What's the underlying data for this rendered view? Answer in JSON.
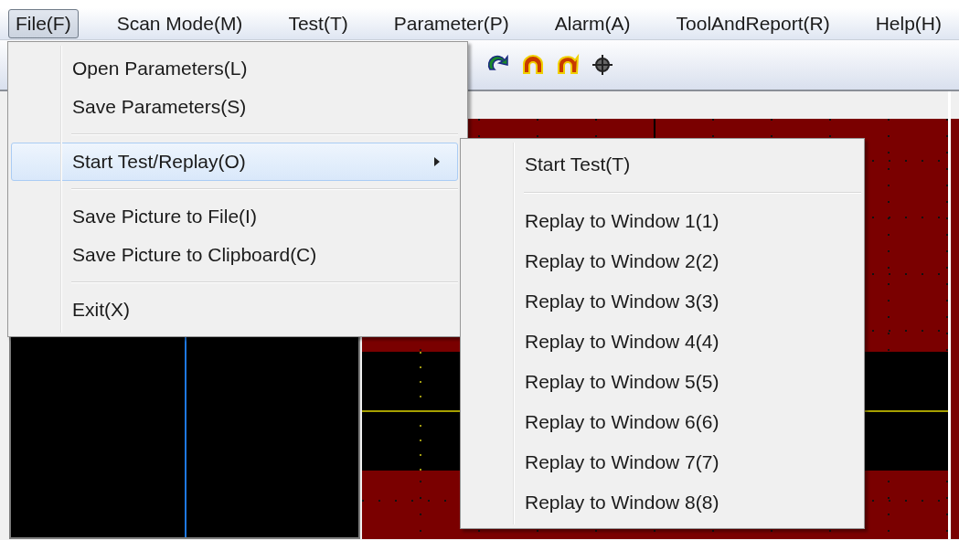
{
  "menubar": [
    {
      "label": "File(F)",
      "selected": true
    },
    {
      "label": "Scan Mode(M)",
      "selected": false
    },
    {
      "label": "Test(T)",
      "selected": false
    },
    {
      "label": "Parameter(P)",
      "selected": false
    },
    {
      "label": "Alarm(A)",
      "selected": false
    },
    {
      "label": "ToolAndReport(R)",
      "selected": false
    },
    {
      "label": "Help(H)",
      "selected": false
    }
  ],
  "file_menu": [
    {
      "kind": "item",
      "label": "Open Parameters(L)",
      "highlighted": false
    },
    {
      "kind": "item",
      "label": "Save Parameters(S)",
      "highlighted": false
    },
    {
      "kind": "separator"
    },
    {
      "kind": "submenu",
      "label": "Start Test/Replay(O)",
      "highlighted": true
    },
    {
      "kind": "separator"
    },
    {
      "kind": "item",
      "label": "Save Picture to File(I)",
      "highlighted": false
    },
    {
      "kind": "item",
      "label": "Save Picture to Clipboard(C)",
      "highlighted": false
    },
    {
      "kind": "separator"
    },
    {
      "kind": "item",
      "label": "Exit(X)",
      "highlighted": false
    }
  ],
  "submenu": [
    {
      "kind": "item",
      "label": "Start Test(T)"
    },
    {
      "kind": "separator"
    },
    {
      "kind": "item",
      "label": "Replay to Window 1(1)"
    },
    {
      "kind": "item",
      "label": "Replay to Window 2(2)"
    },
    {
      "kind": "item",
      "label": "Replay to Window 3(3)"
    },
    {
      "kind": "item",
      "label": "Replay to Window 4(4)"
    },
    {
      "kind": "item",
      "label": "Replay to Window 5(5)"
    },
    {
      "kind": "item",
      "label": "Replay to Window 6(6)"
    },
    {
      "kind": "item",
      "label": "Replay to Window 7(7)"
    },
    {
      "kind": "item",
      "label": "Replay to Window 8(8)"
    }
  ]
}
